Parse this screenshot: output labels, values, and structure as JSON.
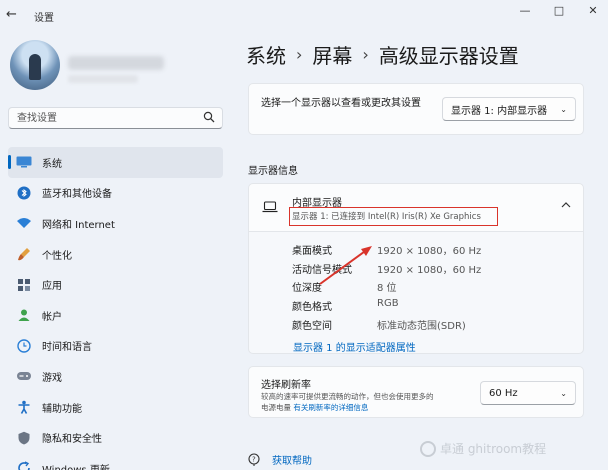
{
  "window": {
    "title": "设置",
    "controls": [
      "—",
      "□",
      "✕"
    ]
  },
  "sidebar": {
    "search_placeholder": "查找设置",
    "items": [
      {
        "label": "系统",
        "icon": "monitor-icon",
        "active": true
      },
      {
        "label": "蓝牙和其他设备",
        "icon": "bluetooth-icon"
      },
      {
        "label": "网络和 Internet",
        "icon": "wifi-icon"
      },
      {
        "label": "个性化",
        "icon": "brush-icon"
      },
      {
        "label": "应用",
        "icon": "apps-icon"
      },
      {
        "label": "帐户",
        "icon": "account-icon"
      },
      {
        "label": "时间和语言",
        "icon": "globe-clock-icon"
      },
      {
        "label": "游戏",
        "icon": "gamepad-icon"
      },
      {
        "label": "辅助功能",
        "icon": "accessibility-icon"
      },
      {
        "label": "隐私和安全性",
        "icon": "shield-icon"
      },
      {
        "label": "Windows 更新",
        "icon": "update-icon"
      }
    ]
  },
  "breadcrumb": {
    "items": [
      "系统",
      "屏幕",
      "高级显示器设置"
    ]
  },
  "display_select": {
    "label": "选择一个显示器以查看或更改其设置",
    "value": "显示器 1: 内部显示器"
  },
  "display_info": {
    "section_title": "显示器信息",
    "name": "内部显示器",
    "subtitle": "显示器 1: 已连接到 Intel(R) Iris(R) Xe Graphics",
    "rows": [
      {
        "key": "桌面模式",
        "value": "1920 × 1080，60 Hz"
      },
      {
        "key": "活动信号模式",
        "value": "1920 × 1080，60 Hz"
      },
      {
        "key": "位深度",
        "value": "8 位"
      },
      {
        "key": "颜色格式",
        "value": "RGB"
      },
      {
        "key": "颜色空间",
        "value": "标准动态范围(SDR)"
      }
    ],
    "adapter_link": "显示器 1 的显示适配器属性"
  },
  "refresh": {
    "title": "选择刷新率",
    "desc_line1": "较高的速率可提供更流畅的动作，但也会使用更多的",
    "desc_line2_prefix": "电源电量",
    "desc_link": "有关刷新率的详细信息",
    "value": "60 Hz"
  },
  "help": {
    "label": "获取帮助"
  },
  "watermark": "卓通 ghitroom教程",
  "colors": {
    "accent": "#0067c0",
    "annotation": "#d9342b"
  }
}
